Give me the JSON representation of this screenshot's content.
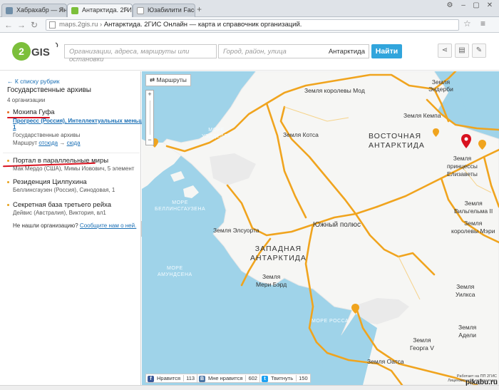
{
  "browser": {
    "tabs": [
      {
        "title": "Хабрахабр — Яндекс…",
        "active": false
      },
      {
        "title": "Антарктида. 2ГИС Он…",
        "active": true
      },
      {
        "title": "Юзабилити Facebook…",
        "active": false
      }
    ],
    "url_host": "maps.2gis.ru",
    "url_separator": " › ",
    "url_title": "Антарктида. 2ГИС Онлайн — карта и справочник организаций."
  },
  "header": {
    "logo_text": "2GIS",
    "search_placeholder": "Организации, адреса, маршруты или остановки",
    "location_placeholder": "Город, район, улица",
    "location_value": "Антарктида",
    "find_button": "Найти",
    "accent_color": "#31a5dc"
  },
  "sidebar": {
    "back_link": "← К списку рубрик",
    "rubric_title": "Государственные архивы",
    "org_count": "4 организации",
    "organizations": [
      {
        "name": "Мохипа Гуфа",
        "publisher": "Прогресс (Россия), Интеллектуальных меньшинств,",
        "publisher_line2": "1",
        "category": "Государственные архивы",
        "route_prefix": "Маршрут",
        "route_from": "отсюда",
        "route_arrow": "→",
        "route_to": "сюда"
      },
      {
        "name": "Портал в параллельные миры",
        "address": "Мак Мердо (США), Мимы Иовович, 5 элемент"
      },
      {
        "name": "Резиденция Цилпухина",
        "address": "Беллинсгаузен (Россия), Синодовая, 1"
      },
      {
        "name": "Секретная база третьего рейха",
        "address": "Дейвис (Австралия), Виктория, вл1"
      }
    ],
    "not_found_text": "Не нашли организацию?",
    "not_found_link": "Сообщите нам о ней."
  },
  "map": {
    "routes_button": "Маршруты",
    "zoom_in": "+",
    "zoom_out": "−",
    "labels": {
      "zemlya_enderbi": "Земля\nЭндерби",
      "zemlya_korolevy_mod": "Земля королевы Мод",
      "zemlya_kempa": "Земля Кемпа",
      "zemlya_kotsa": "Земля Котса",
      "vostochnaya": "ВОСТОЧНАЯ\nАНТАРКТИДА",
      "zemlya_princessy": "Земля\nпринцессы\nЕлизаветы",
      "more_uedella": "МОРЕ\nУЭДДЕЛЛА",
      "more_bellinsgauzena": "МОРЕ\nБЕЛЛИНСГАУЗЕНА",
      "zemlya_vilgelma": "Земля\nВильгельма II",
      "zemlya_korolevy_meri": "Земля\nкоролевы Мэри",
      "zemlya_elsuorta": "Земля Элсуорта",
      "yuzhny_polyus": "Южный полюс",
      "zapadnaya": "ЗАПАДНАЯ\nАНТАРКТИДА",
      "zemlya_meri_berd": "Земля\nМери Бэрд",
      "more_amundsena": "МОРЕ\nАМУНДСЕНА",
      "zemlya_uilksa": "Земля\nУилкса",
      "more_rossa": "МОРЕ РОССА",
      "zemlya_adeli": "Земля\nАдели",
      "zemlya_georga": "Земля\nГеорга V",
      "zemlya_oatsa": "Земля Оатса"
    },
    "social": {
      "fb_label": "Нравится",
      "fb_count": "113",
      "vk_label": "Мне нравится",
      "vk_count": "602",
      "tw_label": "Твитнуть",
      "tw_count": "150"
    },
    "copyright_line1": "Работает на ПП 2ГИС",
    "copyright_line2": "Лицензионное соглашение"
  },
  "watermark": "pikabu.ru"
}
